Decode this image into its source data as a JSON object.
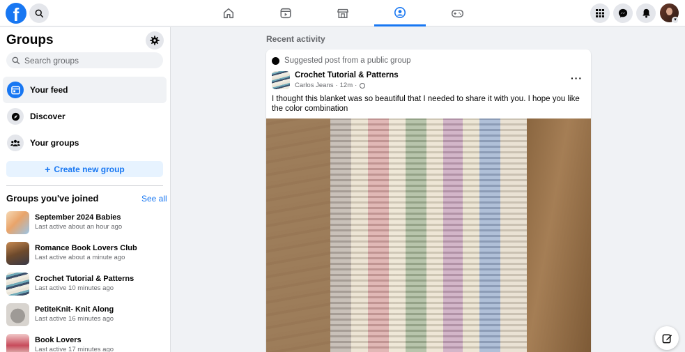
{
  "topbar": {
    "logo": "f",
    "search_icon": "search-icon",
    "nav_icons": [
      "home-icon",
      "watch-icon",
      "marketplace-icon",
      "groups-icon",
      "gaming-icon"
    ],
    "active_tab": "groups",
    "right_icons": [
      "menu-grid-icon",
      "messenger-icon",
      "bell-icon"
    ],
    "accent": "#1877f2"
  },
  "sidebar": {
    "title": "Groups",
    "search_placeholder": "Search groups",
    "nav": [
      {
        "label": "Your feed",
        "icon": "feed-icon"
      },
      {
        "label": "Discover",
        "icon": "compass-icon"
      },
      {
        "label": "Your groups",
        "icon": "people-icon"
      }
    ],
    "create_label": "Create new group",
    "create_plus": "+",
    "joined_title": "Groups you've joined",
    "see_all": "See all",
    "groups": [
      {
        "name": "September 2024 Babies",
        "meta": "Last active about an hour ago"
      },
      {
        "name": "Romance Book Lovers Club",
        "meta": "Last active about a minute ago"
      },
      {
        "name": "Crochet Tutorial & Patterns",
        "meta": "Last active 10 minutes ago"
      },
      {
        "name": "PetiteKnit- Knit Along",
        "meta": "Last active 16 minutes ago"
      },
      {
        "name": "Book Lovers",
        "meta": "Last active 17 minutes ago"
      }
    ]
  },
  "feed": {
    "section_title": "Recent activity",
    "post": {
      "suggested": "Suggested post from a public group",
      "group": "Crochet Tutorial & Patterns",
      "author": "Carlos Jeans",
      "time": "12m",
      "separator": "·",
      "text": "I thought this blanket was so beautiful that I needed to share it with you. I hope you like the color combination",
      "more": "···"
    }
  }
}
